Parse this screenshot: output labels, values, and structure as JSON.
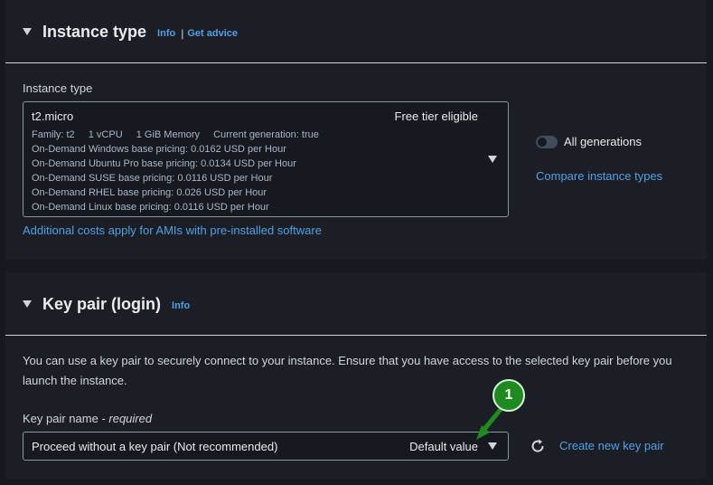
{
  "instance_type_section": {
    "title": "Instance type",
    "info": "Info",
    "separator": "|",
    "get_advice": "Get advice",
    "field_label": "Instance type",
    "selected": {
      "name": "t2.micro",
      "badge": "Free tier eligible",
      "family": "Family: t2",
      "vcpu": "1 vCPU",
      "memory": "1 GiB Memory",
      "generation": "Current generation: true",
      "pricing": [
        "On-Demand Windows base pricing: 0.0162 USD per Hour",
        "On-Demand Ubuntu Pro base pricing: 0.0134 USD per Hour",
        "On-Demand SUSE base pricing: 0.0116 USD per Hour",
        "On-Demand RHEL base pricing: 0.026 USD per Hour",
        "On-Demand Linux base pricing: 0.0116 USD per Hour"
      ]
    },
    "all_generations_label": "All generations",
    "all_generations_on": false,
    "compare_link": "Compare instance types",
    "additional_costs_link": "Additional costs apply for AMIs with pre-installed software"
  },
  "key_pair_section": {
    "title": "Key pair (login)",
    "info": "Info",
    "description": "You can use a key pair to securely connect to your instance. Ensure that you have access to the selected key pair before you launch the instance.",
    "field_label": "Key pair name",
    "field_required": "required",
    "selected_value": "Proceed without a key pair (Not recommended)",
    "default_tag": "Default value",
    "create_link": "Create new key pair"
  },
  "annotation": {
    "badge_number": "1",
    "color": "#1f8a1f"
  }
}
